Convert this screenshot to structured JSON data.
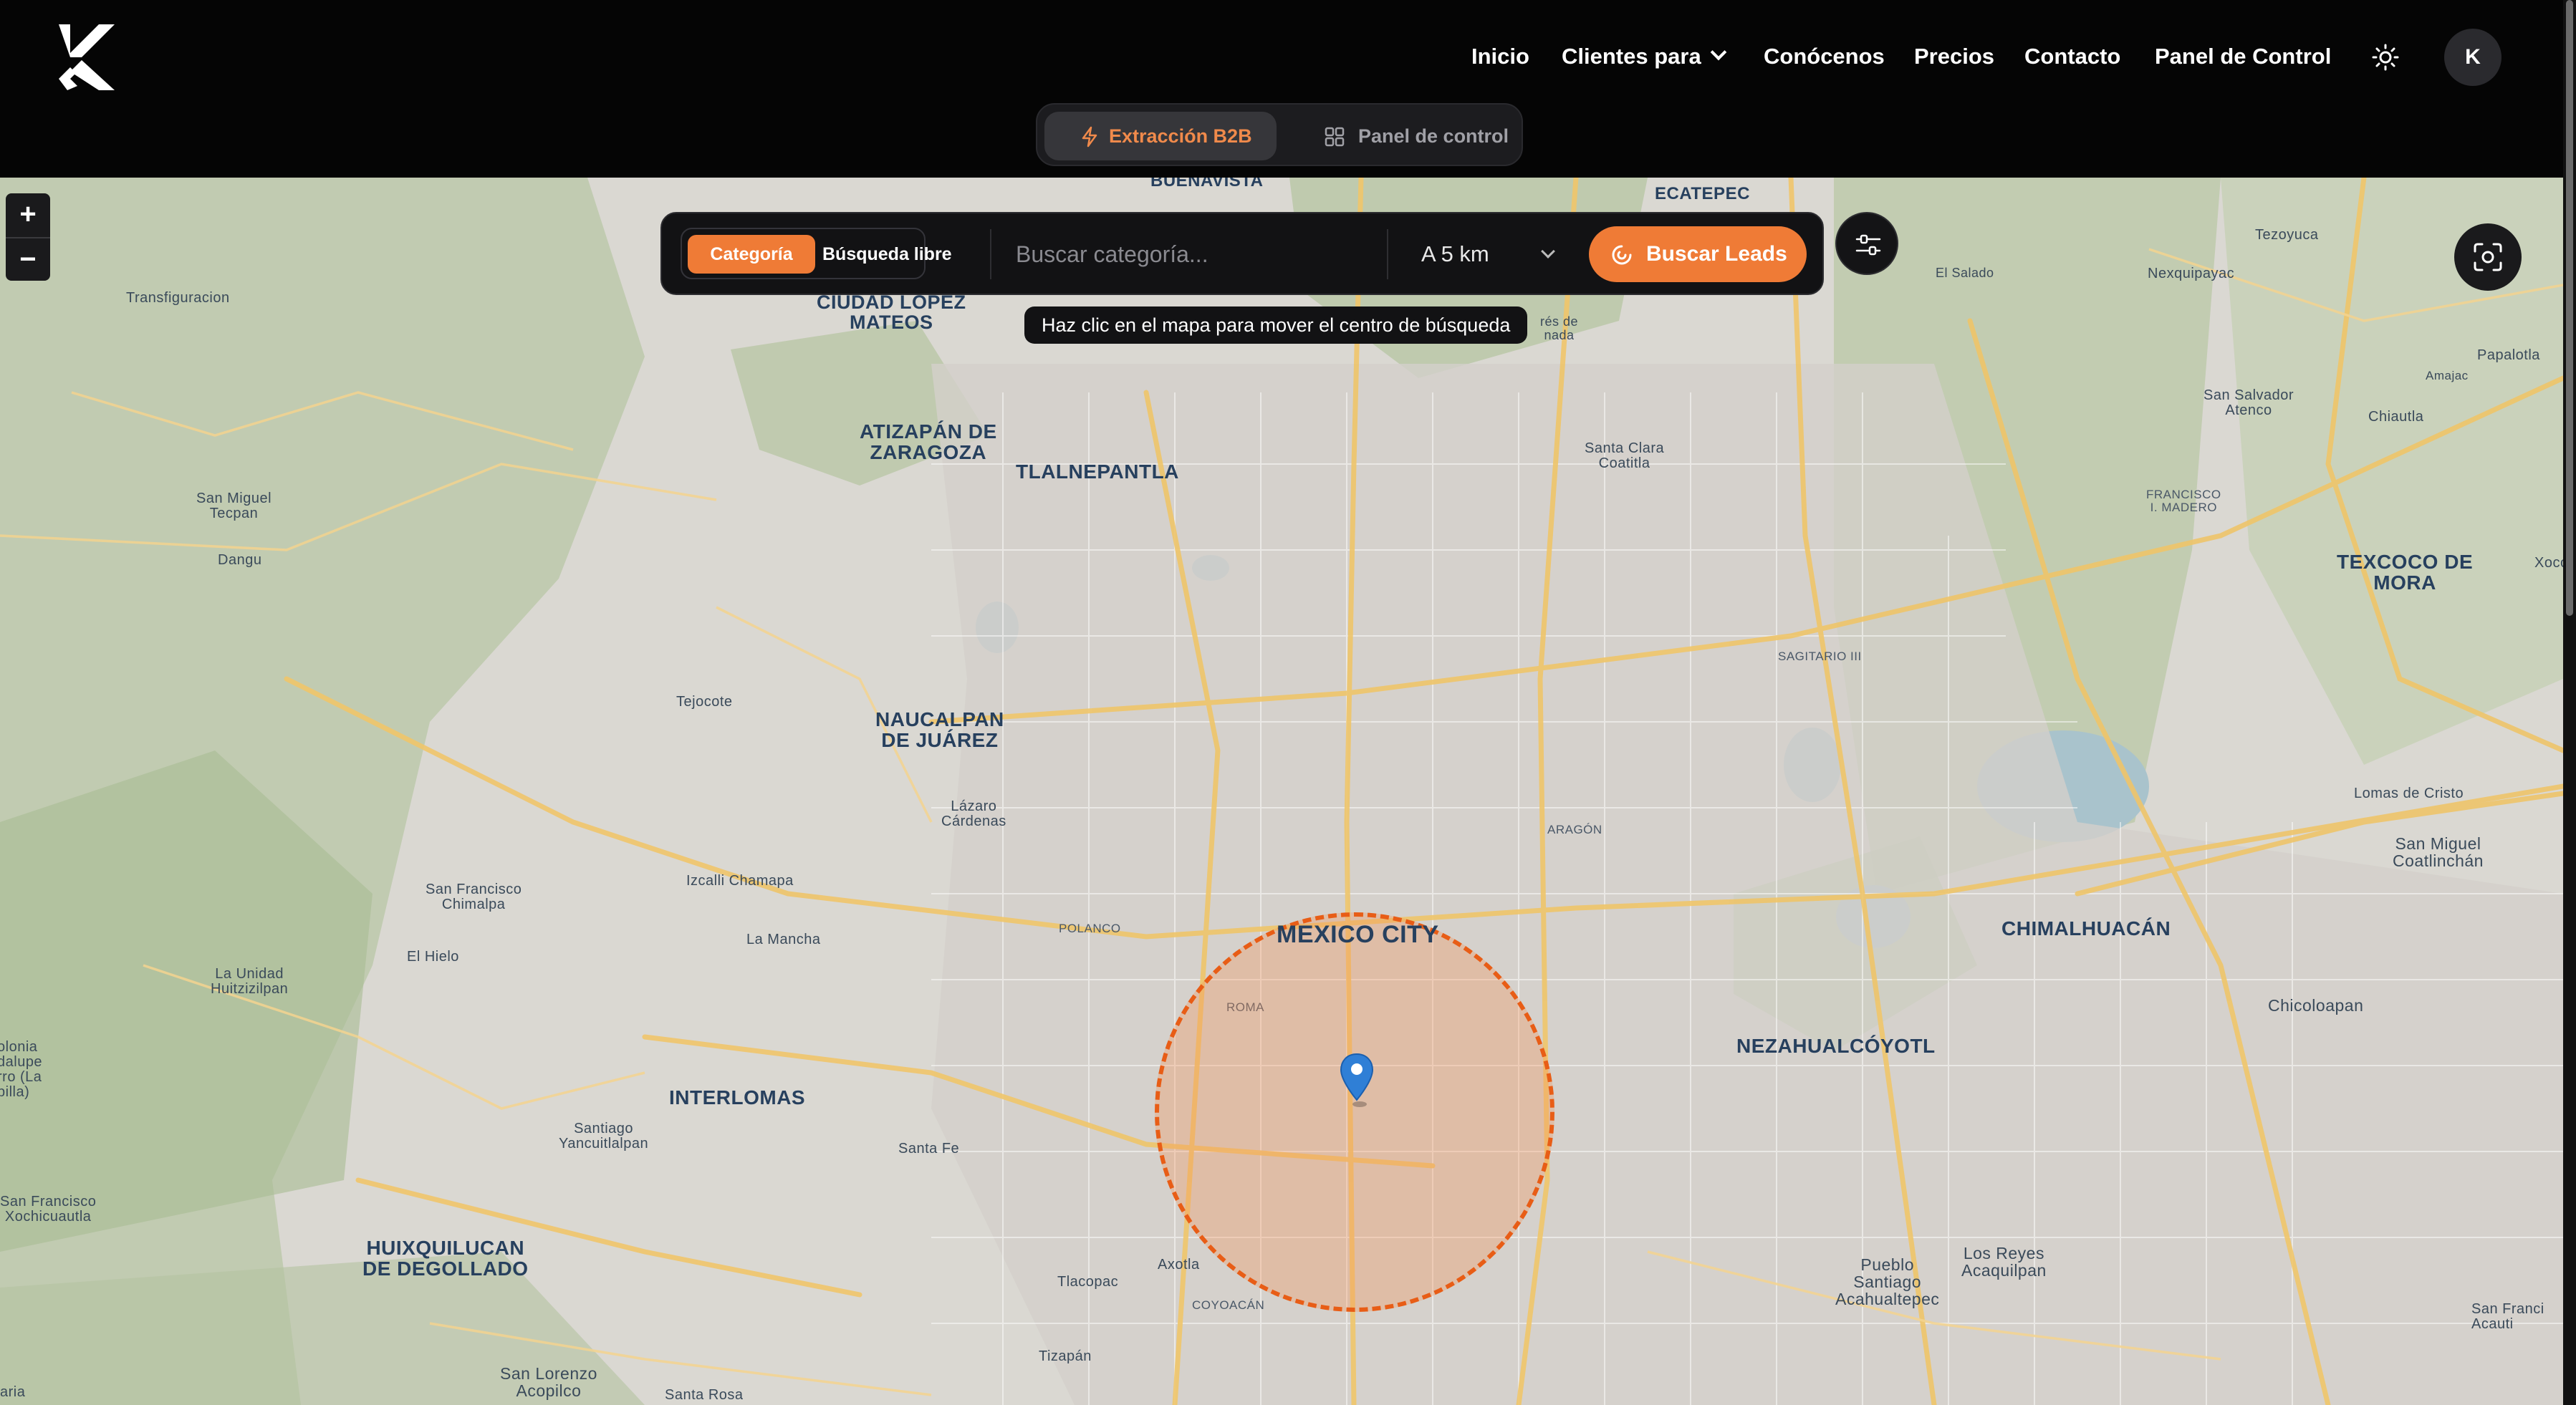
{
  "header": {
    "logo_label": "K",
    "nav": {
      "inicio": "Inicio",
      "clientes": "Clientes para",
      "conocenos": "Conócenos",
      "precios": "Precios",
      "contacto": "Contacto",
      "panel": "Panel de Control"
    },
    "avatar_initial": "K",
    "mode_tabs": {
      "active": "Extracción B2B",
      "inactive": "Panel de control"
    }
  },
  "search": {
    "mode_category": "Categoría",
    "mode_free": "Búsqueda libre",
    "placeholder": "Buscar categoría...",
    "radius": "A 5 km",
    "submit": "Buscar Leads",
    "hint": "Haz clic en el mapa para mover el centro de búsqueda"
  },
  "map": {
    "zoom_in": "+",
    "zoom_out": "−",
    "center_label": "MEXICO CITY",
    "places": {
      "buenavista": "BUENAVISTA",
      "ecatepec": "ECATEPEC",
      "tezoyuca": "Tezoyuca",
      "nexquipayac": "Nexquipayac",
      "el_salado": "El Salado",
      "papalotla": "Papalotla",
      "amajac": "Amajac",
      "san_salvador": "San Salvador\nAtenco",
      "chiautla": "Chiautla",
      "francisco_madero": "FRANCISCO\nI. MADERO",
      "texcoco": "TEXCOCO DE\nMORA",
      "xocot": "Xocot",
      "transfiguracion": "Transfiguracion",
      "ciudad_lopez": "CIUDAD LOPEZ\nMATEOS",
      "atizapan": "ATIZAPÁN DE\nZARAGOZA",
      "tlalnepantla": "TLALNEPANTLA",
      "santa_clara": "Santa Clara\nCoatitla",
      "ares_granada": "rés de\nnada",
      "san_miguel_tecpan": "San Miguel\nTecpan",
      "dangu": "Dangu",
      "sagitario": "SAGITARIO III",
      "tejocote": "Tejocote",
      "naucalpan": "NAUCALPAN\nDE JUÁREZ",
      "lazaro": "Lázaro\nCárdenas",
      "lomas_cristo": "Lomas de Cristo",
      "san_miguel_coatlinchan": "San Miguel\nCoatlinchán",
      "aragon": "ARAGÓN",
      "san_francisco_chimalpa": "San Francisco\nChimalpa",
      "izcalli": "Izcalli Chamapa",
      "polanco": "POLANCO",
      "chimalhuacan": "CHIMALHUACÁN",
      "la_mancha": "La Mancha",
      "el_hielo": "El Hielo",
      "la_unidad": "La Unidad\nHuitzizilpan",
      "roma": "ROMA",
      "chicoloapan": "Chicoloapan",
      "nezahualcoyotl": "NEZAHUALCÓYOTL",
      "colonia_left": "olonia\ndalupe\nrro (La\npilla)",
      "interlomas": "INTERLOMAS",
      "santiago_yancuitlalpan": "Santiago\nYancuitlalpan",
      "santa_fe": "Santa Fe",
      "san_francisco_xochicuautla": "San Francisco\nXochicuautla",
      "huixquilucan": "HUIXQUILUCAN\nDE DEGOLLADO",
      "axotla": "Axotla",
      "los_reyes": "Los Reyes\nAcaquilpan",
      "pueblo_santiago": "Pueblo\nSantiago\nAcahualtepec",
      "san_franci_right": "San Franci\nAcauti",
      "tlacopac": "Tlacopac",
      "coyoacan": "COYOACÁN",
      "tizapan": "Tizapán",
      "san_lorenzo": "San Lorenzo\nAcopilco",
      "santa_rosa": "Santa Rosa",
      "maria": "aria"
    }
  },
  "colors": {
    "accent": "#ef7b36",
    "radius_fill": "#f79256",
    "radius_stroke": "#e85d16",
    "pin": "#2f7fd6",
    "header_bg": "#050505"
  },
  "icons": {
    "logo": "k-logo-icon",
    "theme": "sun-icon",
    "mode_active": "lightning-icon",
    "mode_inactive": "grid-icon",
    "submit": "spinner-icon",
    "filter": "sliders-icon",
    "capture": "camera-focus-icon",
    "pin": "map-pin-icon"
  }
}
